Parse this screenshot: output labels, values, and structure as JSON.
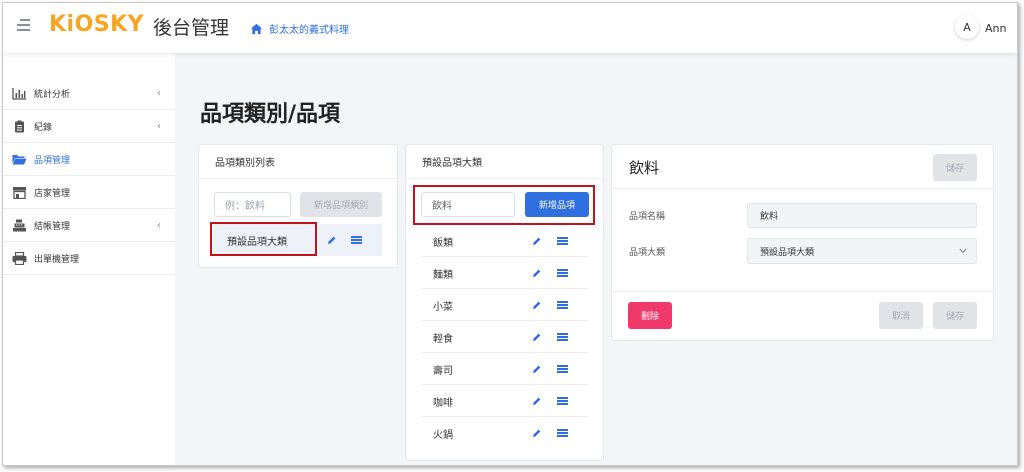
{
  "header": {
    "logo": "KiOSKY",
    "title": "後台管理",
    "store_name": "彭太太的義式料理",
    "avatar_initial": "A",
    "username": "Ann"
  },
  "sidebar": {
    "items": [
      {
        "label": "統計分析",
        "icon": "bar-chart-icon",
        "has_submenu": true
      },
      {
        "label": "紀錄",
        "icon": "clipboard-icon",
        "has_submenu": true
      },
      {
        "label": "品項管理",
        "icon": "folder-open-icon",
        "active": true
      },
      {
        "label": "店家管理",
        "icon": "store-icon"
      },
      {
        "label": "結帳管理",
        "icon": "cash-register-icon",
        "has_submenu": true
      },
      {
        "label": "出單機管理",
        "icon": "printer-icon"
      }
    ],
    "chevron": "‹"
  },
  "page_title": "品項類別/品項",
  "category_list": {
    "title": "品項類別列表",
    "input_placeholder": "例：飲料",
    "add_button": "新增品項類別",
    "items": [
      "預設品項大類"
    ]
  },
  "default_category": {
    "title": "預設品項大類",
    "input_value": "飲料",
    "add_button": "新增品項",
    "items": [
      "飯類",
      "麵類",
      "小菜",
      "輕食",
      "壽司",
      "咖啡",
      "火鍋"
    ]
  },
  "detail": {
    "title": "飲料",
    "save_top": "儲存",
    "name_label": "品項名稱",
    "name_value": "飲料",
    "category_label": "品項大類",
    "category_value": "預設品項大類",
    "delete_button": "刪除",
    "cancel_button": "取消",
    "save_bottom": "儲存"
  },
  "colors": {
    "accent": "#2f6fde",
    "logo": "#f5a623",
    "danger": "#f0386b",
    "highlight": "#c0121f"
  }
}
